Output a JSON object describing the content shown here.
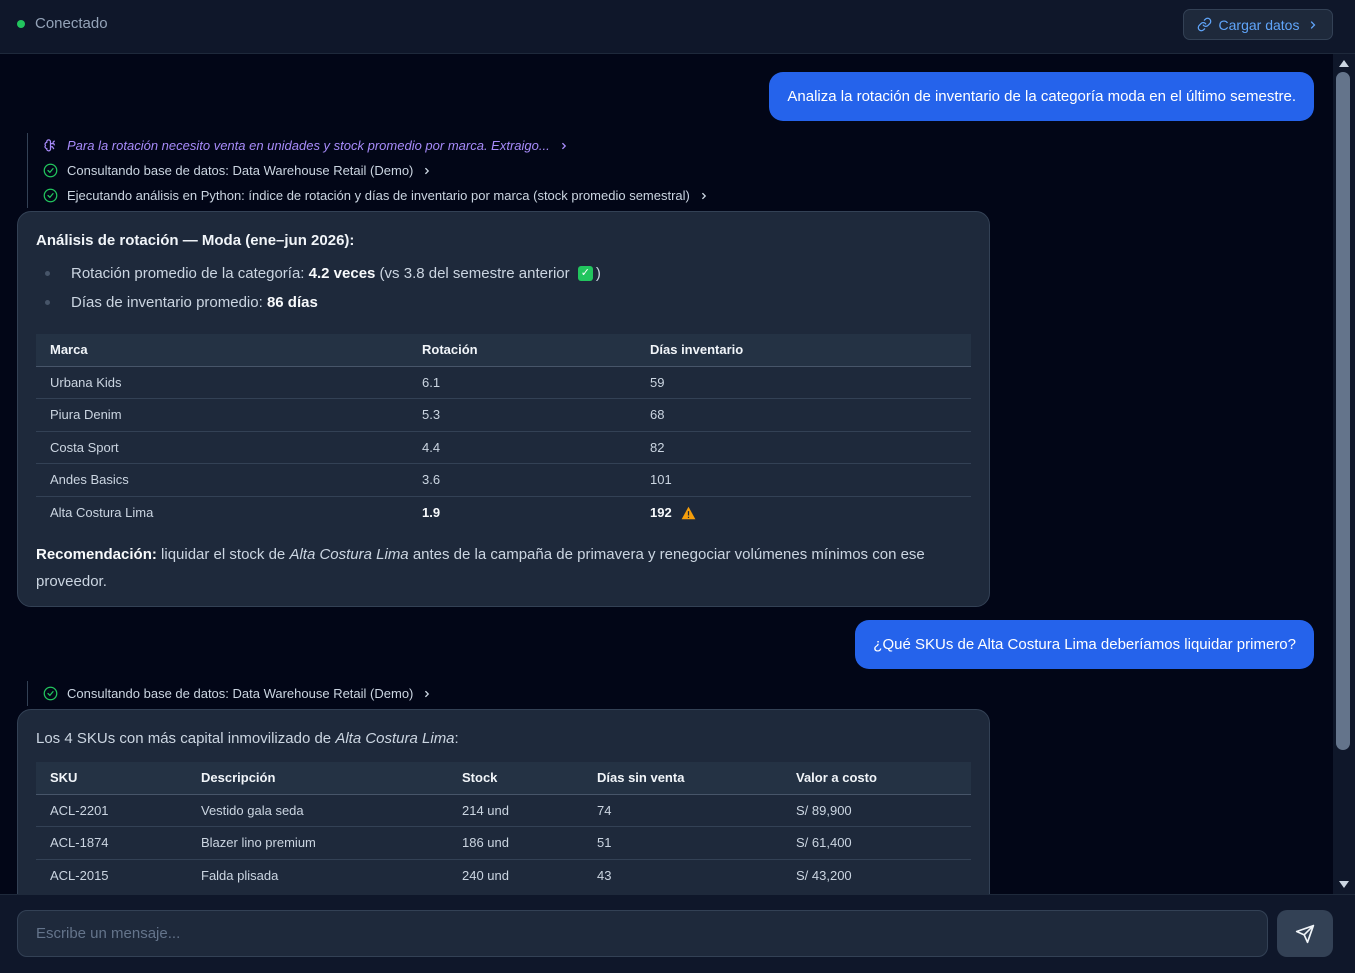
{
  "header": {
    "status_text": "Conectado",
    "status_color": "#22c55e",
    "load_button_label": "Cargar datos",
    "load_button_icon": "link-icon"
  },
  "conversation": {
    "user_message_1": "Analiza la rotación de inventario de la categoría moda en el último semestre.",
    "steps_1": [
      {
        "label": "Para la rotación necesito venta en unidades y stock promedio por marca. Extraigo...",
        "icon": "brain-icon"
      },
      {
        "label": "Consultando base de datos: Data Warehouse Retail (Demo)",
        "icon": "check-circle-icon"
      },
      {
        "label": "Ejecutando análisis en Python: índice de rotación y días de inventario por marca (stock promedio semestral)",
        "icon": "check-circle-icon"
      }
    ],
    "answer_1": {
      "title": "Análisis de rotación — Moda (ene–jun 2026):",
      "bullet_1_prefix": "Rotación promedio de la categoría: ",
      "bullet_1_value": "4.2 veces",
      "bullet_1_suffix_a": " (vs 3.8 del semestre anterior ",
      "bullet_1_emoji": "✓",
      "bullet_1_suffix_b": ")",
      "bullet_2_prefix": "Días de inventario promedio: ",
      "bullet_2_value": "86 días",
      "table_headers": [
        "Marca",
        "Rotación",
        "Días inventario"
      ],
      "table_rows": [
        [
          "Urbana Kids",
          "6.1",
          "59"
        ],
        [
          "Piura Denim",
          "5.3",
          "68"
        ],
        [
          "Costa Sport",
          "4.4",
          "82"
        ],
        [
          "Andes Basics",
          "3.6",
          "101"
        ],
        [
          "Alta Costura Lima",
          "1.9",
          "192"
        ]
      ],
      "reco_label": "Recomendación:",
      "reco_text_1": " liquidar el stock de ",
      "reco_brand": "Alta Costura Lima",
      "reco_text_2": " antes de la campaña de primavera y renegociar volúmenes mínimos con ese proveedor."
    },
    "user_message_2": "¿Qué SKUs de Alta Costura Lima deberíamos liquidar primero?",
    "steps_2": [
      {
        "label": "Consultando base de datos: Data Warehouse Retail (Demo)",
        "icon": "check-circle-icon"
      }
    ],
    "answer_2": {
      "intro": "Los 4 SKUs con más capital inmovilizado de ",
      "intro_brand": "Alta Costura Lima",
      "intro_end": ":",
      "table_headers": [
        "SKU",
        "Descripción",
        "Stock",
        "Días sin venta",
        "Valor a costo"
      ],
      "table_rows": [
        [
          "ACL-2201",
          "Vestido gala seda",
          "214 und",
          "74",
          "S/ 89,900"
        ],
        [
          "ACL-1874",
          "Blazer lino premium",
          "186 und",
          "51",
          "S/ 61,400"
        ],
        [
          "ACL-2015",
          "Falda plisada",
          "240 und",
          "43",
          "S/ 43,200"
        ]
      ]
    }
  },
  "composer": {
    "placeholder": "Escribe un mensaje...",
    "send_icon": "send-icon"
  }
}
